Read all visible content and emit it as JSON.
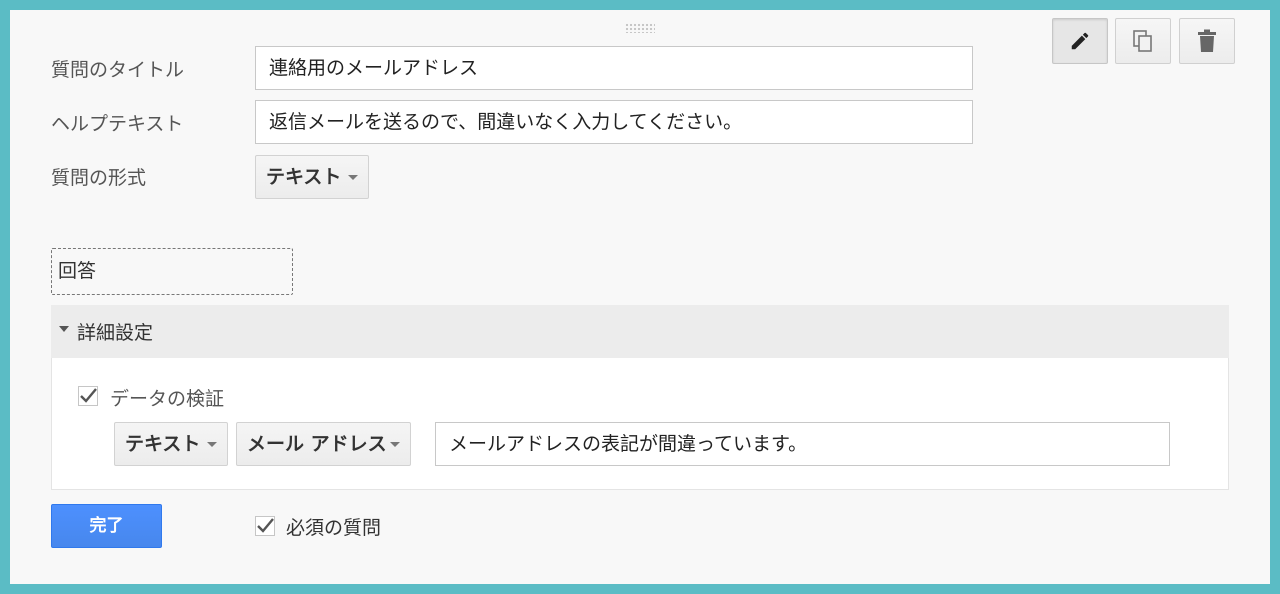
{
  "question": {
    "title_label": "質問のタイトル",
    "title_value": "連絡用のメールアドレス",
    "help_label": "ヘルプテキスト",
    "help_value": "返信メールを送るので、間違いなく入力してください。",
    "type_label": "質問の形式",
    "type_value": "テキスト"
  },
  "toolbar": {
    "edit_icon": "pencil-icon",
    "duplicate_icon": "duplicate-icon",
    "delete_icon": "trash-icon"
  },
  "answer": {
    "placeholder": "回答"
  },
  "advanced": {
    "title": "詳細設定",
    "validation": {
      "label": "データの検証",
      "checked": true,
      "type_value": "テキスト",
      "subtype_value": "メール アドレス",
      "error_text": "メールアドレスの表記が間違っています。"
    }
  },
  "footer": {
    "done_label": "完了",
    "required_label": "必須の質問",
    "required_checked": true
  },
  "colors": {
    "frame": "#5bbcc5",
    "primary_button": "#4d90fe"
  }
}
